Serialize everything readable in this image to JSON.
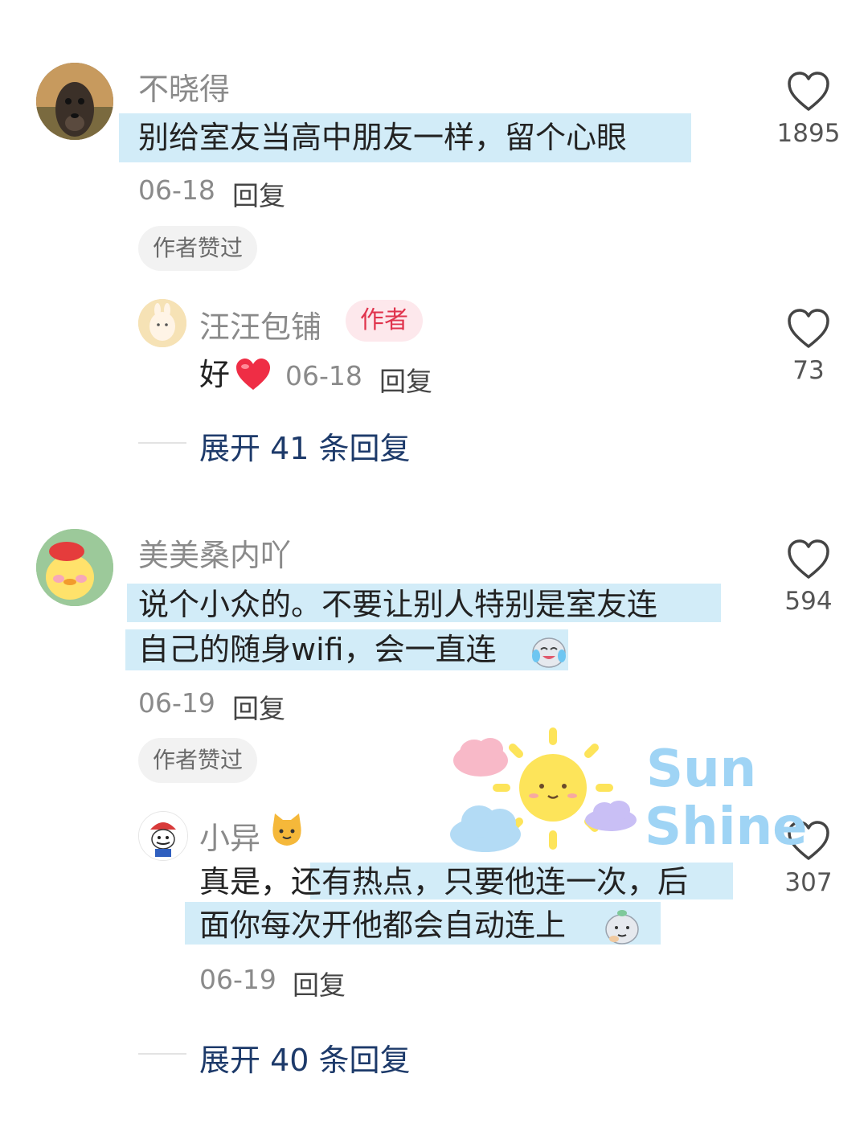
{
  "comments": [
    {
      "user": "不晓得",
      "text": "别给室友当高中朋友一样，留个心眼",
      "date": "06-18",
      "reply_label": "回复",
      "badge": "作者赞过",
      "likes": "1895",
      "sub_reply": {
        "user": "汪汪包铺",
        "tag": "作者",
        "text": "好",
        "date": "06-18",
        "reply_label": "回复",
        "likes": "73"
      },
      "expand_label": "展开 41 条回复"
    },
    {
      "user": "美美桑内吖",
      "text_line1": "说个小众的。不要让别人特别是室友连",
      "text_line2": "自己的随身wifi，会一直连",
      "date": "06-19",
      "reply_label": "回复",
      "badge": "作者赞过",
      "likes": "594",
      "sub_reply": {
        "user": "小异",
        "text_line1_a": "真是，还",
        "text_line1_b": "有热点，只要他连一次，后",
        "text_line2": "面你每次开他都会自动连上",
        "date": "06-19",
        "reply_label": "回复",
        "likes": "307"
      },
      "expand_label": "展开 40 条回复"
    }
  ],
  "sticker": {
    "line1": "Sun",
    "line2": "Shine"
  },
  "colors": {
    "highlight": "#d2ecf8",
    "author_tag": "#e0344d",
    "expand": "#1d3a6a"
  }
}
